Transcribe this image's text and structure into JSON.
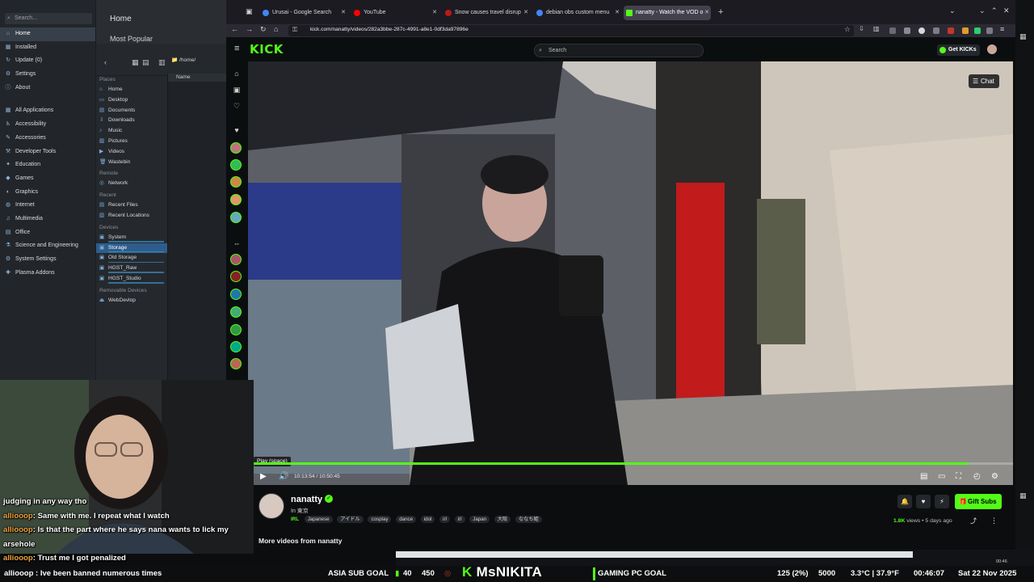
{
  "launcher": {
    "search_placeholder": "Search...",
    "items": [
      {
        "label": "Home",
        "icon": "home-icon",
        "active": true
      },
      {
        "label": "Installed",
        "icon": "installed-icon"
      },
      {
        "label": "Update (0)",
        "icon": "update-icon"
      },
      {
        "label": "Settings",
        "icon": "settings-icon"
      },
      {
        "label": "About",
        "icon": "info-icon"
      }
    ],
    "categories": [
      "All Applications",
      "Accessibility",
      "Accessories",
      "Developer Tools",
      "Education",
      "Games",
      "Graphics",
      "Internet",
      "Multimedia",
      "Office",
      "Science and Engineering",
      "System Settings",
      "Plasma Addons"
    ]
  },
  "filemgr": {
    "home_title": "Home",
    "most_popular": "Most Popular",
    "path": "/home/",
    "column_name": "Name",
    "places_header": "Places",
    "places": [
      "Home",
      "Desktop",
      "Documents",
      "Downloads",
      "Music",
      "Pictures",
      "Videos",
      "Wastebin"
    ],
    "remote_header": "Remote",
    "remote": [
      "Network"
    ],
    "recent_header": "Recent",
    "recent": [
      "Recent Files",
      "Recent Locations"
    ],
    "devices_header": "Devices",
    "devices": [
      "System",
      "Storage",
      "Old Storage",
      "HGST_Raw",
      "HGST_Studio"
    ],
    "removable_header": "Removable Devices",
    "removable": [
      "WebDevlop"
    ]
  },
  "browser": {
    "tabs": [
      {
        "label": "Urusai - Google Search",
        "color": "#4285f4"
      },
      {
        "label": "YouTube",
        "color": "#ff0000"
      },
      {
        "label": "Snow causes travel disrup",
        "color": "#bb1919"
      },
      {
        "label": "debian obs custom menu",
        "color": "#4285f4"
      },
      {
        "label": "nanatty - Watch the VOD o",
        "color": "#53fc18",
        "active": true
      }
    ],
    "url": "kick.com/nanatty/videos/282a3bbe-287c-4991-a8e1-0df3da97896e"
  },
  "kick": {
    "logo": "KICK",
    "search_placeholder": "Search",
    "get_kicks": "Get KICKs",
    "chat_button": "Chat",
    "tooltip": "Play (space)",
    "time": "10:13:54 / 10:50:45",
    "progress_fraction": 0.942,
    "channel_name": "nanatty",
    "category_prefix": "In",
    "category": "東京",
    "irl": "IRL",
    "tags": [
      "Japanese",
      "アイドル",
      "cosplay",
      "dance",
      "idol",
      "irl",
      "irl",
      "Japan",
      "大阪",
      "ななち姫"
    ],
    "gift_subs": "Gift Subs",
    "views": "1.8K",
    "views_suffix": "views",
    "posted": "• 5 days ago",
    "more_videos": "More videos from nanatty",
    "accent": "#53fc18"
  },
  "chat": [
    {
      "user": "",
      "text": "judging in any way tho"
    },
    {
      "user": "alliooop",
      "text": ": Same with me. I repeat what I watch"
    },
    {
      "user": "alliooop",
      "text": ": Is that the part where he says nana wants to lick my"
    },
    {
      "user": "",
      "text": "arsehole"
    },
    {
      "user": "alliooop",
      "text": ": Trust me I got penalized"
    }
  ],
  "streambar": {
    "last_chat": "alliooop : Ive been banned numerous times",
    "asia_goal": "ASIA SUB GOAL",
    "asia_num_a": "40",
    "asia_num_b": "450",
    "channel_k": "K",
    "channel": "MsNIKITA",
    "pc_goal": "GAMING PC GOAL",
    "pc_progress": "125 (2%)",
    "pc_target": "5000",
    "weather": "3.3°C | 37.9°F",
    "uptime": "00:46:07",
    "date": "Sat 22 Nov 2025"
  },
  "tray": {
    "clock": "00:46"
  }
}
